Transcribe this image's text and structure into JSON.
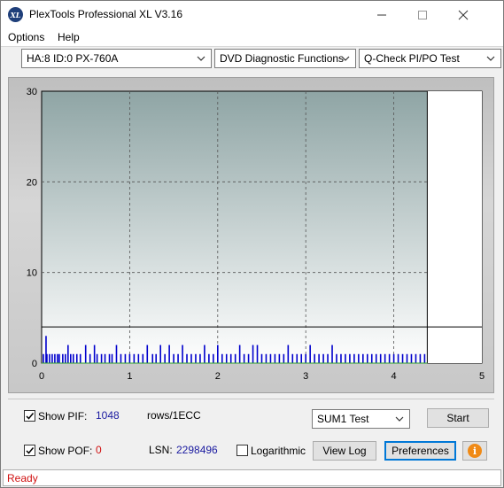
{
  "window": {
    "title": "PlexTools Professional XL V3.16",
    "icon_text": "XL"
  },
  "menu": {
    "options": "Options",
    "help": "Help"
  },
  "toolbar": {
    "drive": "HA:8 ID:0  PX-760A",
    "function": "DVD Diagnostic Functions",
    "test": "Q-Check PI/PO Test"
  },
  "chart_data": {
    "type": "bar",
    "xlim": [
      0,
      5
    ],
    "ylim": [
      0,
      30
    ],
    "x_ticks": [
      "0",
      "1",
      "2",
      "3",
      "4",
      "5"
    ],
    "y_ticks": [
      "0",
      "10",
      "20",
      "30"
    ],
    "grid": true,
    "threshold": 4,
    "scan_end": 4.38,
    "series": [
      {
        "color": "#0000cc",
        "x": [
          0.02,
          0.05,
          0.06,
          0.09,
          0.12,
          0.15,
          0.18,
          0.2,
          0.24,
          0.27,
          0.3,
          0.33,
          0.36,
          0.4,
          0.44,
          0.5,
          0.55,
          0.6,
          0.63,
          0.68,
          0.72,
          0.77,
          0.8,
          0.85,
          0.9,
          0.95,
          1.0,
          1.05,
          1.1,
          1.15,
          1.2,
          1.26,
          1.3,
          1.35,
          1.4,
          1.45,
          1.5,
          1.55,
          1.6,
          1.65,
          1.7,
          1.75,
          1.8,
          1.85,
          1.9,
          1.95,
          2.0,
          2.05,
          2.1,
          2.15,
          2.2,
          2.25,
          2.3,
          2.35,
          2.4,
          2.45,
          2.5,
          2.55,
          2.6,
          2.65,
          2.7,
          2.75,
          2.8,
          2.85,
          2.9,
          2.95,
          3.0,
          3.05,
          3.1,
          3.15,
          3.2,
          3.25,
          3.3,
          3.35,
          3.4,
          3.45,
          3.5,
          3.55,
          3.6,
          3.65,
          3.7,
          3.75,
          3.8,
          3.85,
          3.9,
          3.95,
          4.0,
          4.05,
          4.1,
          4.15,
          4.2,
          4.25,
          4.3,
          4.35
        ],
        "values": [
          1,
          3,
          1,
          1,
          1,
          1,
          1,
          1,
          1,
          1,
          2,
          1,
          1,
          1,
          1,
          2,
          1,
          2,
          1,
          1,
          1,
          1,
          1,
          2,
          1,
          1,
          1,
          1,
          1,
          1,
          2,
          1,
          1,
          2,
          1,
          2,
          1,
          1,
          2,
          1,
          1,
          1,
          1,
          2,
          1,
          1,
          2,
          1,
          1,
          1,
          1,
          2,
          1,
          1,
          2,
          2,
          1,
          1,
          1,
          1,
          1,
          1,
          2,
          1,
          1,
          1,
          1,
          2,
          1,
          1,
          1,
          1,
          2,
          1,
          1,
          1,
          1,
          1,
          1,
          1,
          1,
          1,
          1,
          1,
          1,
          1,
          1,
          1,
          1,
          1,
          1,
          1,
          1,
          1
        ]
      }
    ]
  },
  "controls": {
    "show_pif_label": "Show PIF:",
    "pif_value": "1048",
    "pif_unit": "rows/1ECC",
    "show_pof_label": "Show POF:",
    "pof_value": "0",
    "lsn_label": "LSN:",
    "lsn_value": "2298496",
    "logarithmic_label": "Logarithmic",
    "sum_test": "SUM1 Test",
    "start": "Start",
    "view_log": "View Log",
    "preferences": "Preferences",
    "info_icon_text": "i"
  },
  "status": {
    "text": "Ready"
  }
}
